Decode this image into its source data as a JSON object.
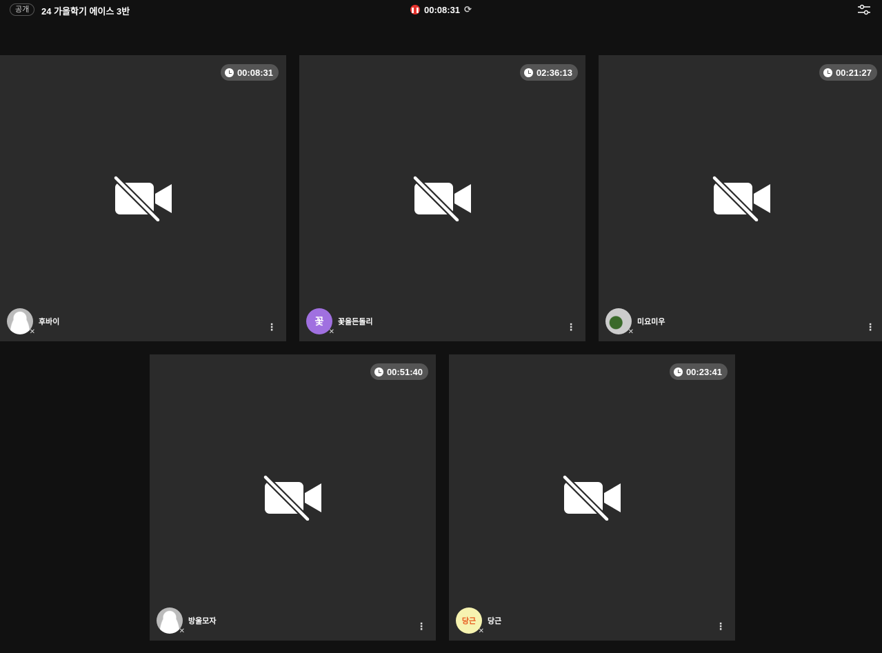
{
  "header": {
    "visibility_badge": "공개",
    "room_title": "24 가을학기 에이스 3반",
    "recording_time": "00:08:31"
  },
  "tiles": [
    {
      "name": "후바이",
      "timer": "00:08:31",
      "avatar": "default",
      "avatar_text": ""
    },
    {
      "name": "꽃을든돌리",
      "timer": "02:36:13",
      "avatar": "text",
      "avatar_text": "꽃"
    },
    {
      "name": "미요미우",
      "timer": "00:21:27",
      "avatar": "image",
      "avatar_text": ""
    },
    {
      "name": "방울모자",
      "timer": "00:51:40",
      "avatar": "default",
      "avatar_text": ""
    },
    {
      "name": "당근",
      "timer": "00:23:41",
      "avatar": "logo",
      "avatar_text": "당근"
    }
  ],
  "colors": {
    "record": "#e5322d",
    "avatar_purple": "#a070e0"
  }
}
